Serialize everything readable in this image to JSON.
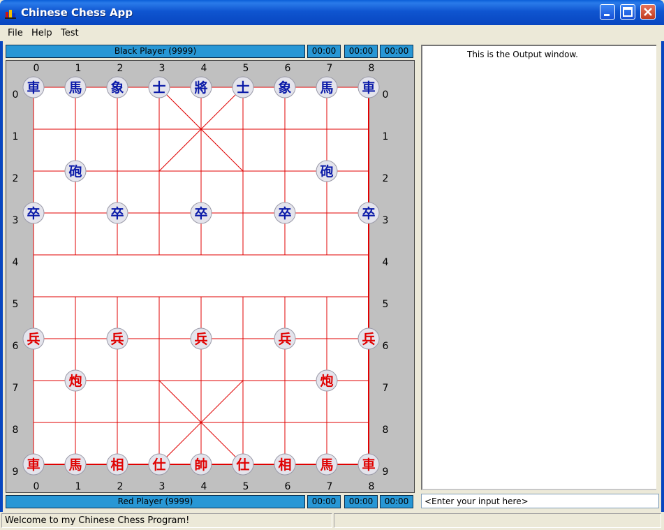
{
  "window": {
    "title": "Chinese Chess App"
  },
  "menu": [
    "File",
    "Help",
    "Test"
  ],
  "black_player": {
    "label": "Black Player (9999)",
    "timers": [
      "00:00",
      "00:00",
      "00:00"
    ]
  },
  "red_player": {
    "label": "Red Player (9999)",
    "timers": [
      "00:00",
      "00:00",
      "00:00"
    ]
  },
  "board": {
    "col_labels": [
      "0",
      "1",
      "2",
      "3",
      "4",
      "5",
      "6",
      "7",
      "8"
    ],
    "row_labels": [
      "0",
      "1",
      "2",
      "3",
      "4",
      "5",
      "6",
      "7",
      "8",
      "9"
    ],
    "colors": {
      "background": "#c0c0c0",
      "grid": "#e00000",
      "black_piece": "#0a1aa8",
      "red_piece": "#e00000",
      "piece_face": "#e4e4ec"
    },
    "pieces": [
      {
        "char": "車",
        "side": "black",
        "col": 0,
        "row": 0
      },
      {
        "char": "馬",
        "side": "black",
        "col": 1,
        "row": 0
      },
      {
        "char": "象",
        "side": "black",
        "col": 2,
        "row": 0
      },
      {
        "char": "士",
        "side": "black",
        "col": 3,
        "row": 0
      },
      {
        "char": "將",
        "side": "black",
        "col": 4,
        "row": 0
      },
      {
        "char": "士",
        "side": "black",
        "col": 5,
        "row": 0
      },
      {
        "char": "象",
        "side": "black",
        "col": 6,
        "row": 0
      },
      {
        "char": "馬",
        "side": "black",
        "col": 7,
        "row": 0
      },
      {
        "char": "車",
        "side": "black",
        "col": 8,
        "row": 0
      },
      {
        "char": "砲",
        "side": "black",
        "col": 1,
        "row": 2
      },
      {
        "char": "砲",
        "side": "black",
        "col": 7,
        "row": 2
      },
      {
        "char": "卒",
        "side": "black",
        "col": 0,
        "row": 3
      },
      {
        "char": "卒",
        "side": "black",
        "col": 2,
        "row": 3
      },
      {
        "char": "卒",
        "side": "black",
        "col": 4,
        "row": 3
      },
      {
        "char": "卒",
        "side": "black",
        "col": 6,
        "row": 3
      },
      {
        "char": "卒",
        "side": "black",
        "col": 8,
        "row": 3
      },
      {
        "char": "兵",
        "side": "red",
        "col": 0,
        "row": 6
      },
      {
        "char": "兵",
        "side": "red",
        "col": 2,
        "row": 6
      },
      {
        "char": "兵",
        "side": "red",
        "col": 4,
        "row": 6
      },
      {
        "char": "兵",
        "side": "red",
        "col": 6,
        "row": 6
      },
      {
        "char": "兵",
        "side": "red",
        "col": 8,
        "row": 6
      },
      {
        "char": "炮",
        "side": "red",
        "col": 1,
        "row": 7
      },
      {
        "char": "炮",
        "side": "red",
        "col": 7,
        "row": 7
      },
      {
        "char": "車",
        "side": "red",
        "col": 0,
        "row": 9
      },
      {
        "char": "馬",
        "side": "red",
        "col": 1,
        "row": 9
      },
      {
        "char": "相",
        "side": "red",
        "col": 2,
        "row": 9
      },
      {
        "char": "仕",
        "side": "red",
        "col": 3,
        "row": 9
      },
      {
        "char": "帥",
        "side": "red",
        "col": 4,
        "row": 9
      },
      {
        "char": "仕",
        "side": "red",
        "col": 5,
        "row": 9
      },
      {
        "char": "相",
        "side": "red",
        "col": 6,
        "row": 9
      },
      {
        "char": "馬",
        "side": "red",
        "col": 7,
        "row": 9
      },
      {
        "char": "車",
        "side": "red",
        "col": 8,
        "row": 9
      }
    ]
  },
  "output": {
    "text": "This is the Output window."
  },
  "input": {
    "placeholder": "<Enter your input here>"
  },
  "status": {
    "message": "Welcome to my Chinese Chess Program!"
  }
}
